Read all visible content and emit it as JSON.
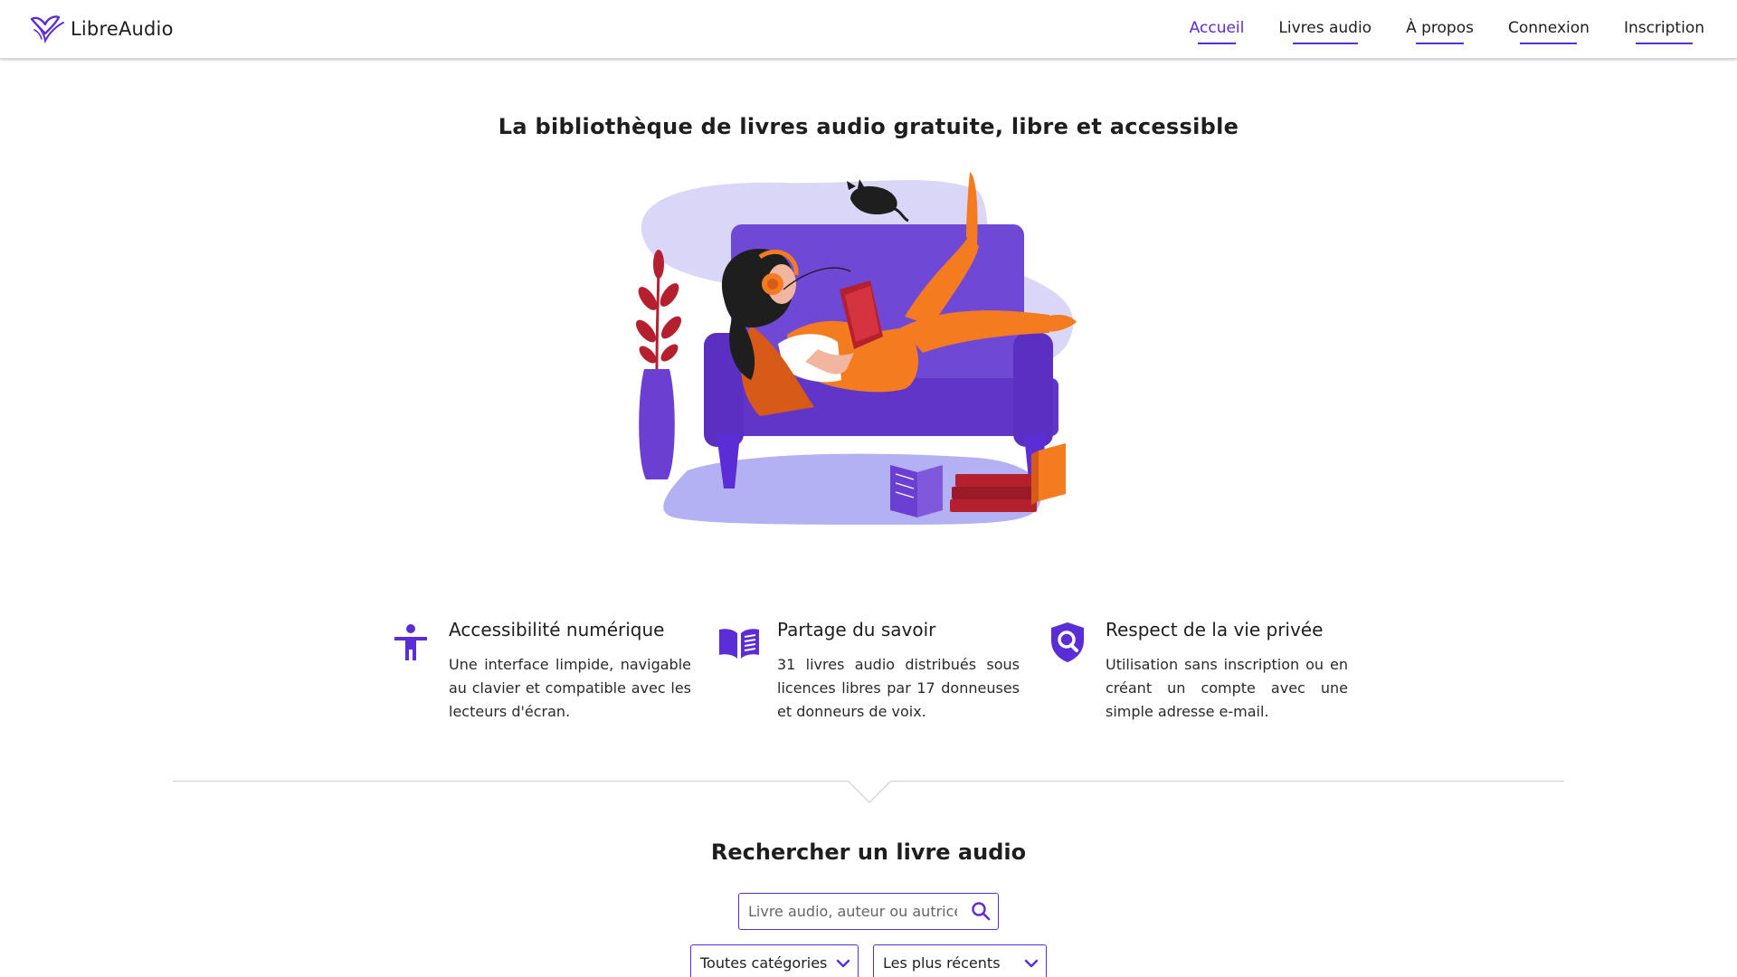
{
  "header": {
    "brand_name": "LibreAudio",
    "nav": [
      {
        "label": "Accueil",
        "active": true
      },
      {
        "label": "Livres audio"
      },
      {
        "label": "À propos"
      },
      {
        "label": "Connexion"
      },
      {
        "label": "Inscription"
      }
    ]
  },
  "hero": {
    "tagline": "La bibliothèque de livres audio gratuite, libre et accessible",
    "illustration": "woman-listening-audiobook-on-sofa"
  },
  "features": [
    {
      "icon": "accessibility-icon",
      "title": "Accessibilité numérique",
      "description": "Une interface limpide, navigable au clavier et compatible avec les lecteurs d'écran."
    },
    {
      "icon": "book-icon",
      "title": "Partage du savoir",
      "description": "31 livres audio distribués sous licences libres par 17 donneuses et donneurs de voix."
    },
    {
      "icon": "privacy-shield-icon",
      "title": "Respect de la vie privée",
      "description": "Utilisation sans inscription ou en créant un compte avec une simple adresse e-mail."
    }
  ],
  "search": {
    "title": "Rechercher un livre audio",
    "placeholder": "Livre audio, auteur ou autrice",
    "category_select": "Toutes catégories",
    "sort_select": "Les plus récents"
  },
  "colors": {
    "accent": "#5a2dd6",
    "purple_light": "#d9d6f7",
    "orange": "#f47b20",
    "red": "#b5202e",
    "text": "#1e1e1e"
  }
}
